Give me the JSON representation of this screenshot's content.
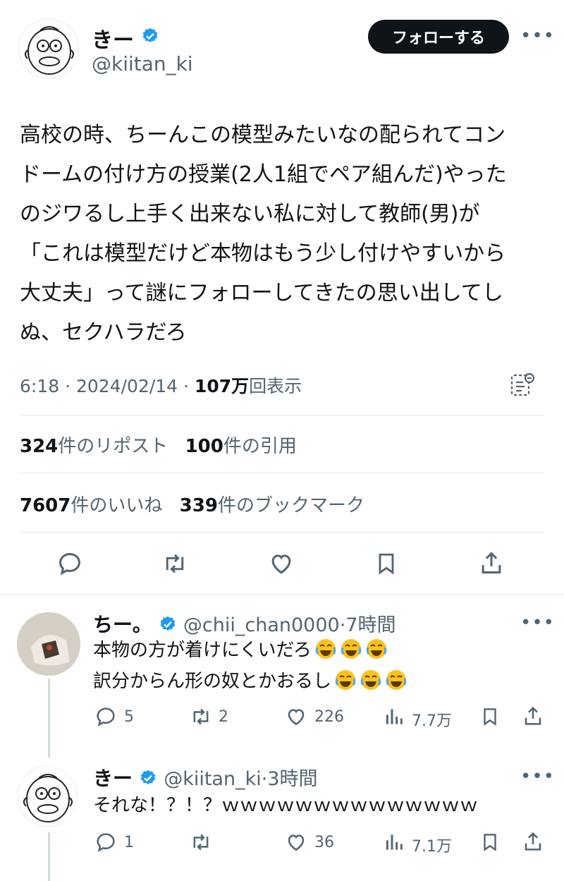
{
  "main_post": {
    "author": {
      "name": "きー",
      "handle": "@kiitan_ki",
      "verified": true
    },
    "follow_label": "フォローする",
    "more_label": "•••",
    "body_lines": [
      "高校の時、ちーんこの模型みたいなの配られてコン",
      "ドームの付け方の授業(2人1組でペア組んだ)やった",
      "のジワるし上手く出来ない私に対して教師(男)が",
      "「これは模型だけど本物はもう少し付けやすいから",
      "大丈夫」って謎にフォローしてきたの思い出してし",
      "ぬ、セクハラだろ"
    ],
    "meta": {
      "time": "6:18",
      "date": "2024/02/14",
      "views": "107万",
      "views_suffix": "回表示",
      "sep": "·"
    },
    "stats": {
      "reposts": "324",
      "reposts_label": "件のリポスト",
      "quotes": "100",
      "quotes_label": "件の引用",
      "likes": "7607",
      "likes_label": "件のいいね",
      "bookmarks": "339",
      "bookmarks_label": "件のブックマーク"
    }
  },
  "replies": [
    {
      "name": "ちー。",
      "handle": "@chii_chan0000",
      "time": "·7時間",
      "lines": [
        "本物の方が着けにくいだろ",
        "訳分からん形の奴とかおるし"
      ],
      "reply_count": "5",
      "repost_count": "2",
      "like_count": "226",
      "view_count": "7.7万"
    },
    {
      "name": "きー",
      "handle": "@kiitan_ki",
      "time": "·3時間",
      "lines": [
        "それな！？！？ｗｗｗｗｗｗｗｗｗｗｗｗｗｗ"
      ],
      "reply_count": "1",
      "repost_count": "",
      "like_count": "36",
      "view_count": "7.1万"
    }
  ],
  "colors": {
    "verified": "#1d9bf0",
    "text": "#0f1419",
    "muted": "#536471",
    "divider": "#e6e9ec"
  }
}
